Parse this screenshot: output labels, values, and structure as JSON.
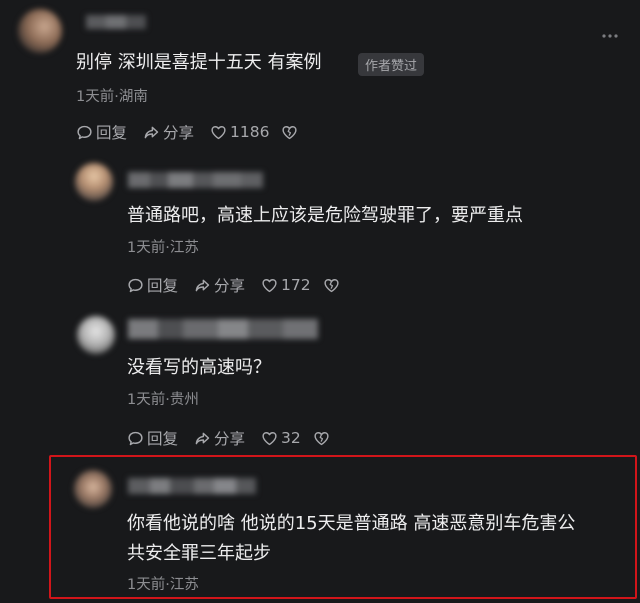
{
  "comments": [
    {
      "text": "别停 深圳是喜提十五天 有案例",
      "badge": "作者赞过",
      "meta": "1天前·湖南",
      "reply_label": "回复",
      "share_label": "分享",
      "like_count": "1186"
    },
    {
      "text": "普通路吧，高速上应该是危险驾驶罪了，要严重点",
      "meta": "1天前·江苏",
      "reply_label": "回复",
      "share_label": "分享",
      "like_count": "172"
    },
    {
      "text": "没看写的高速吗？",
      "meta": "1天前·贵州",
      "reply_label": "回复",
      "share_label": "分享",
      "like_count": "32"
    },
    {
      "text_line1": "你看他说的啥 他说的15天是普通路 高速恶意别车危害公",
      "text_line2": "共安全罪三年起步",
      "meta": "1天前·江苏"
    }
  ],
  "icons": {
    "more": "more-dots-icon",
    "reply": "comment-bubble-icon",
    "share": "share-arrow-icon",
    "like": "heart-icon",
    "dislike": "broken-heart-icon"
  },
  "colors": {
    "background": "#18191b",
    "highlight_border": "#d1151a",
    "text_primary": "#ededee",
    "text_secondary": "#8d8e92"
  }
}
